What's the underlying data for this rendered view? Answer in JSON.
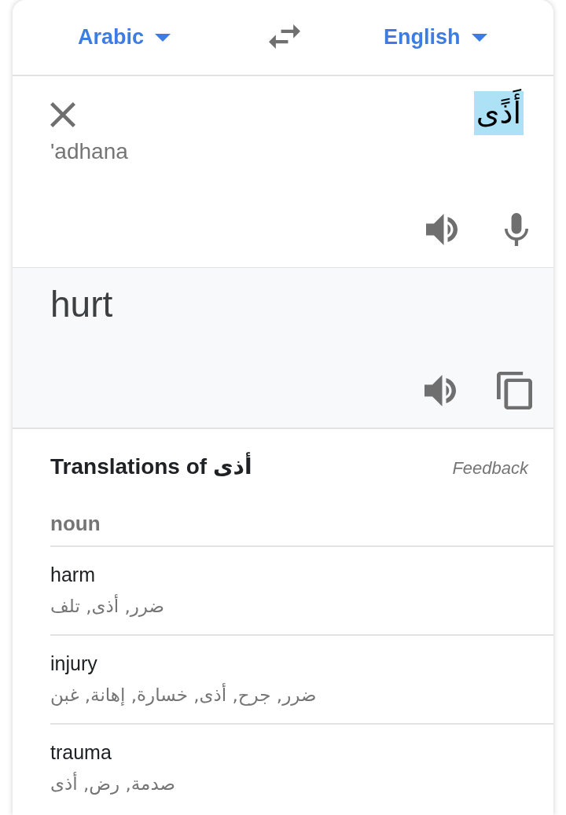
{
  "header": {
    "source_language": "Arabic",
    "target_language": "English"
  },
  "input": {
    "text": "أَذًى",
    "text_selected": true,
    "transliteration": "'adhana"
  },
  "output": {
    "text": "hurt"
  },
  "dictionary": {
    "title": "Translations of أذى",
    "feedback": "Feedback",
    "groups": [
      {
        "part_of_speech": "noun",
        "entries": [
          {
            "word": "harm",
            "synonyms": "ضرر, أذى, تلف"
          },
          {
            "word": "injury",
            "synonyms": "ضرر, جرح, أذى, خسارة, إهانة, غبن"
          },
          {
            "word": "trauma",
            "synonyms": "صدمة, رض, أذى"
          }
        ]
      }
    ]
  }
}
